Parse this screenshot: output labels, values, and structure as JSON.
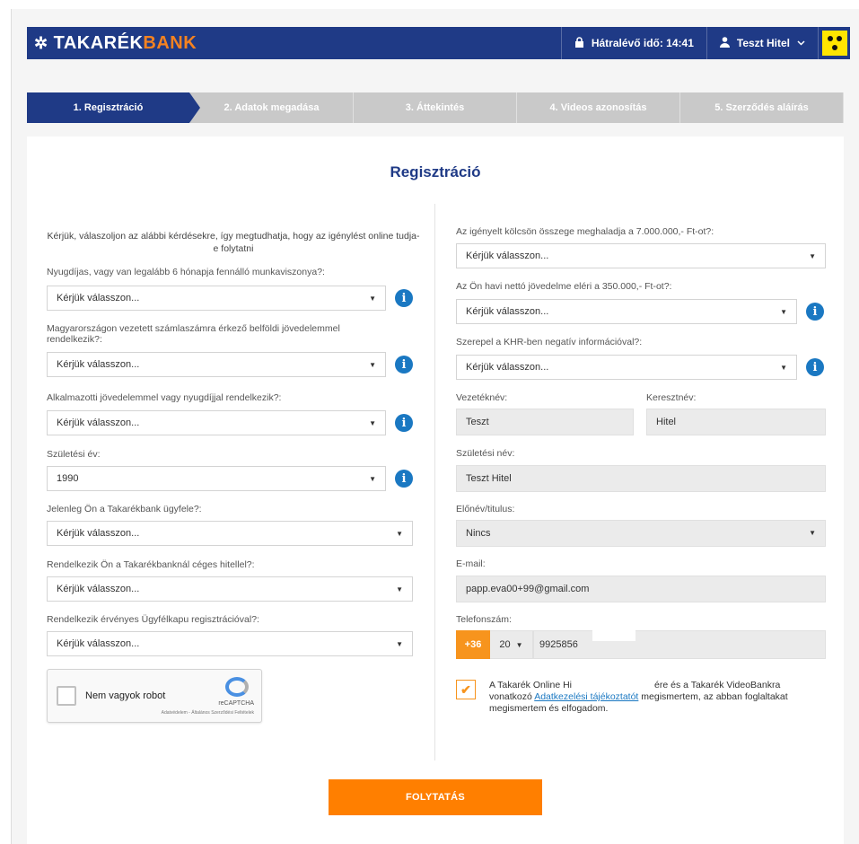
{
  "brand": {
    "star": "✲",
    "part1": "TAKARÉK",
    "part2": "BANK"
  },
  "header": {
    "timer_label": "Hátralévő idő: 14:41",
    "user_name": "Teszt Hitel"
  },
  "steps": [
    {
      "label": "1. Regisztráció"
    },
    {
      "label": "2. Adatok megadása"
    },
    {
      "label": "3. Áttekintés"
    },
    {
      "label": "4. Videos azonosítás"
    },
    {
      "label": "5. Szerződés aláírás"
    }
  ],
  "page_title": "Regisztráció",
  "left": {
    "intro": "Kérjük, válaszoljon az alábbi kérdésekre, így megtudhatja, hogy az igénylést online tudja-e folytatni",
    "q_pension": {
      "label": "Nyugdíjas, vagy van legalább 6 hónapja fennálló munkaviszonya?:",
      "value": "Kérjük válasszon..."
    },
    "q_income": {
      "label": "Magyarországon vezetett számlaszámra érkező belföldi jövedelemmel rendelkezik?:",
      "value": "Kérjük válasszon..."
    },
    "q_employ": {
      "label": "Alkalmazotti jövedelemmel vagy nyugdíjjal rendelkezik?:",
      "value": "Kérjük válasszon..."
    },
    "q_birthyear": {
      "label": "Születési év:",
      "value": "1990"
    },
    "q_client": {
      "label": "Jelenleg Ön a Takarékbank ügyfele?:",
      "value": "Kérjük válasszon..."
    },
    "q_company": {
      "label": "Rendelkezik Ön a Takarékbanknál céges hitellel?:",
      "value": "Kérjük válasszon..."
    },
    "q_gateway": {
      "label": "Rendelkezik érvényes Ügyfélkapu regisztrációval?:",
      "value": "Kérjük válasszon..."
    },
    "captcha": {
      "label": "Nem vagyok robot",
      "brand": "reCAPTCHA",
      "terms": "Adatvédelem - Általános Szerződési Feltételek"
    }
  },
  "right": {
    "q_amount": {
      "label": "Az igényelt kölcsön összege meghaladja a 7.000.000,- Ft-ot?:",
      "value": "Kérjük válasszon..."
    },
    "q_netincome": {
      "label": "Az Ön havi nettó jövedelme eléri a 350.000,- Ft-ot?:",
      "value": "Kérjük válasszon..."
    },
    "q_khr": {
      "label": "Szerepel a KHR-ben negatív információval?:",
      "value": "Kérjük válasszon..."
    },
    "lastname": {
      "label": "Vezetéknév:",
      "value": "Teszt"
    },
    "firstname": {
      "label": "Keresztnév:",
      "value": "Hitel"
    },
    "birthname": {
      "label": "Születési név:",
      "value": "Teszt Hitel"
    },
    "title_field": {
      "label": "Előnév/titulus:",
      "value": "Nincs"
    },
    "email": {
      "label": "E-mail:",
      "value": "papp.eva00+99@gmail.com"
    },
    "phone": {
      "label": "Telefonszám:",
      "prefix": "+36",
      "area": "20",
      "number": "9925856"
    },
    "consent": {
      "text_before": "A Takarék Online Hi",
      "text_middle": "ére és a Takarék VideoBankra vonatkozó ",
      "link": "Adatkezelési tájékoztatót",
      "text_after": " megismertem, az abban foglaltakat megismertem és elfogadom."
    }
  },
  "submit_label": "FOLYTATÁS",
  "colors": {
    "navy": "#1f3a86",
    "orange": "#ff7f00",
    "info_blue": "#1a78c2"
  }
}
